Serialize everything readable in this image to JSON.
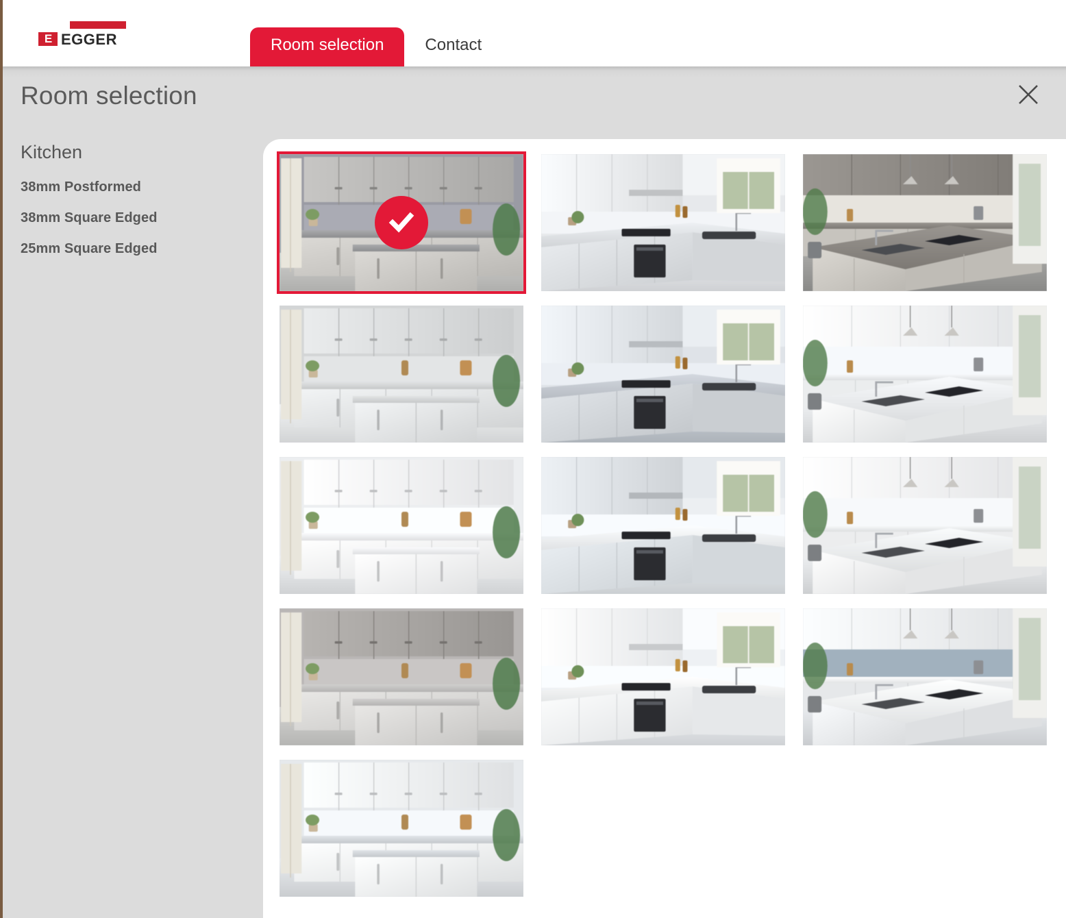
{
  "brand": {
    "logo_text": "EGGER",
    "logo_mark": "E",
    "accent_color": "#e31937"
  },
  "header": {
    "tabs": [
      {
        "label": "Room selection",
        "active": true
      },
      {
        "label": "Contact",
        "active": false
      }
    ]
  },
  "modal": {
    "title": "Room selection",
    "close_icon": "close-icon"
  },
  "sidebar": {
    "heading": "Kitchen",
    "items": [
      {
        "label": "38mm Postformed"
      },
      {
        "label": "38mm Square Edged"
      },
      {
        "label": "25mm Square Edged"
      }
    ]
  },
  "gallery": {
    "selected_index": 0,
    "selected_badge_icon": "check-icon",
    "thumbnails": [
      {
        "name": "grey-shaker-kitchen-with-island",
        "selected": true,
        "palette": {
          "wall": "#9a9ba4",
          "upper": "#b9b8b6",
          "counter": "#9fa0a2",
          "base": "#cfcdc9",
          "floor": "#c9c9c7"
        }
      },
      {
        "name": "white-handleless-l-shape-kitchen-with-oven",
        "selected": false,
        "palette": {
          "wall": "#e7e9ec",
          "upper": "#eceef0",
          "counter": "#e3e6e9",
          "base": "#dfe2e5",
          "floor": "#e9ebee"
        }
      },
      {
        "name": "taupe-island-kitchen-with-bar-stools",
        "selected": false,
        "palette": {
          "wall": "#d9d6d0",
          "upper": "#8d8984",
          "counter": "#8f8b86",
          "base": "#cfccc6",
          "floor": "#a3a3a1"
        }
      },
      {
        "name": "light-grey-galley-kitchen-with-sink",
        "selected": false,
        "palette": {
          "wall": "#d3d5d6",
          "upper": "#dcdedf",
          "counter": "#d8dadb",
          "base": "#e6e8e9",
          "floor": "#eceeef"
        }
      },
      {
        "name": "u-shaped-kitchen-with-palm-plant",
        "selected": false,
        "palette": {
          "wall": "#dfe3e8",
          "upper": "#e4e8ec",
          "counter": "#c9ced5",
          "base": "#d6dade",
          "floor": "#c7cdd4"
        }
      },
      {
        "name": "white-kitchen-with-open-shelving-round-sink",
        "selected": false,
        "palette": {
          "wall": "#e8ebee",
          "upper": "#f1f3f5",
          "counter": "#eef0f2",
          "base": "#f3f5f6",
          "floor": "#e8eaec"
        }
      },
      {
        "name": "white-kitchen-with-shelf-unit-and-bread",
        "selected": false,
        "palette": {
          "wall": "#eceef0",
          "upper": "#f3f4f6",
          "counter": "#f0f1f3",
          "base": "#f5f6f7",
          "floor": "#eaecee"
        }
      },
      {
        "name": "peninsula-kitchen-with-patio-doors",
        "selected": false,
        "palette": {
          "wall": "#eceff2",
          "upper": "#dfe3e7",
          "counter": "#f2f4f6",
          "base": "#dfe4e8",
          "floor": "#e5e9ec"
        }
      },
      {
        "name": "white-kitchen-with-larder-shelves",
        "selected": false,
        "palette": {
          "wall": "#e9ebed",
          "upper": "#f2f3f5",
          "counter": "#eff1f2",
          "base": "#f4f5f6",
          "floor": "#e7e9eb"
        }
      },
      {
        "name": "grey-kitchen-with-tall-shelf-and-jars",
        "selected": false,
        "palette": {
          "wall": "#b9b6b5",
          "upper": "#a9a6a3",
          "counter": "#c6c5c4",
          "base": "#dcdbd9",
          "floor": "#cfcfcd"
        }
      },
      {
        "name": "white-kitchen-with-double-oven-tower",
        "selected": false,
        "palette": {
          "wall": "#eef1f4",
          "upper": "#f4f6f8",
          "counter": "#f6f8f9",
          "base": "#f2f4f6",
          "floor": "#e9ecef"
        }
      },
      {
        "name": "white-island-kitchen-with-berries",
        "selected": false,
        "palette": {
          "wall": "#93a3b0",
          "upper": "#eef0f2",
          "counter": "#f4f6f7",
          "base": "#eef0f2",
          "floor": "#e3e6e9"
        }
      },
      {
        "name": "white-kitchen-with-oven-and-eggs",
        "selected": false,
        "palette": {
          "wall": "#e6e9ec",
          "upper": "#eff1f3",
          "counter": "#d6dade",
          "base": "#f2f4f5",
          "floor": "#e4e7ea"
        }
      }
    ]
  }
}
